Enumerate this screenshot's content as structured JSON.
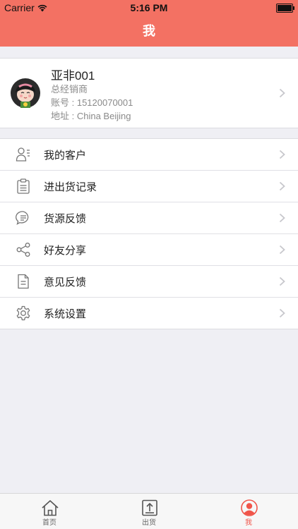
{
  "status_bar": {
    "carrier": "Carrier",
    "time": "5:16 PM"
  },
  "nav": {
    "title": "我"
  },
  "profile": {
    "name": "亚非001",
    "role": "总经销商",
    "account": "账号 : 15120070001",
    "address": "地址 : China Beijing"
  },
  "menu": [
    {
      "label": "我的客户",
      "icon": "customers-icon"
    },
    {
      "label": "进出货记录",
      "icon": "clipboard-icon"
    },
    {
      "label": "货源反馈",
      "icon": "chat-bubble-icon"
    },
    {
      "label": "好友分享",
      "icon": "share-icon"
    },
    {
      "label": "意见反馈",
      "icon": "document-icon"
    },
    {
      "label": "系统设置",
      "icon": "gear-icon"
    }
  ],
  "tabbar": {
    "tabs": [
      {
        "label": "首页",
        "icon": "home-icon"
      },
      {
        "label": "出货",
        "icon": "upload-icon"
      },
      {
        "label": "我",
        "icon": "user-icon"
      }
    ],
    "active_color": "#f0554a"
  },
  "colors": {
    "accent": "#f37163",
    "background": "#efeff4"
  }
}
